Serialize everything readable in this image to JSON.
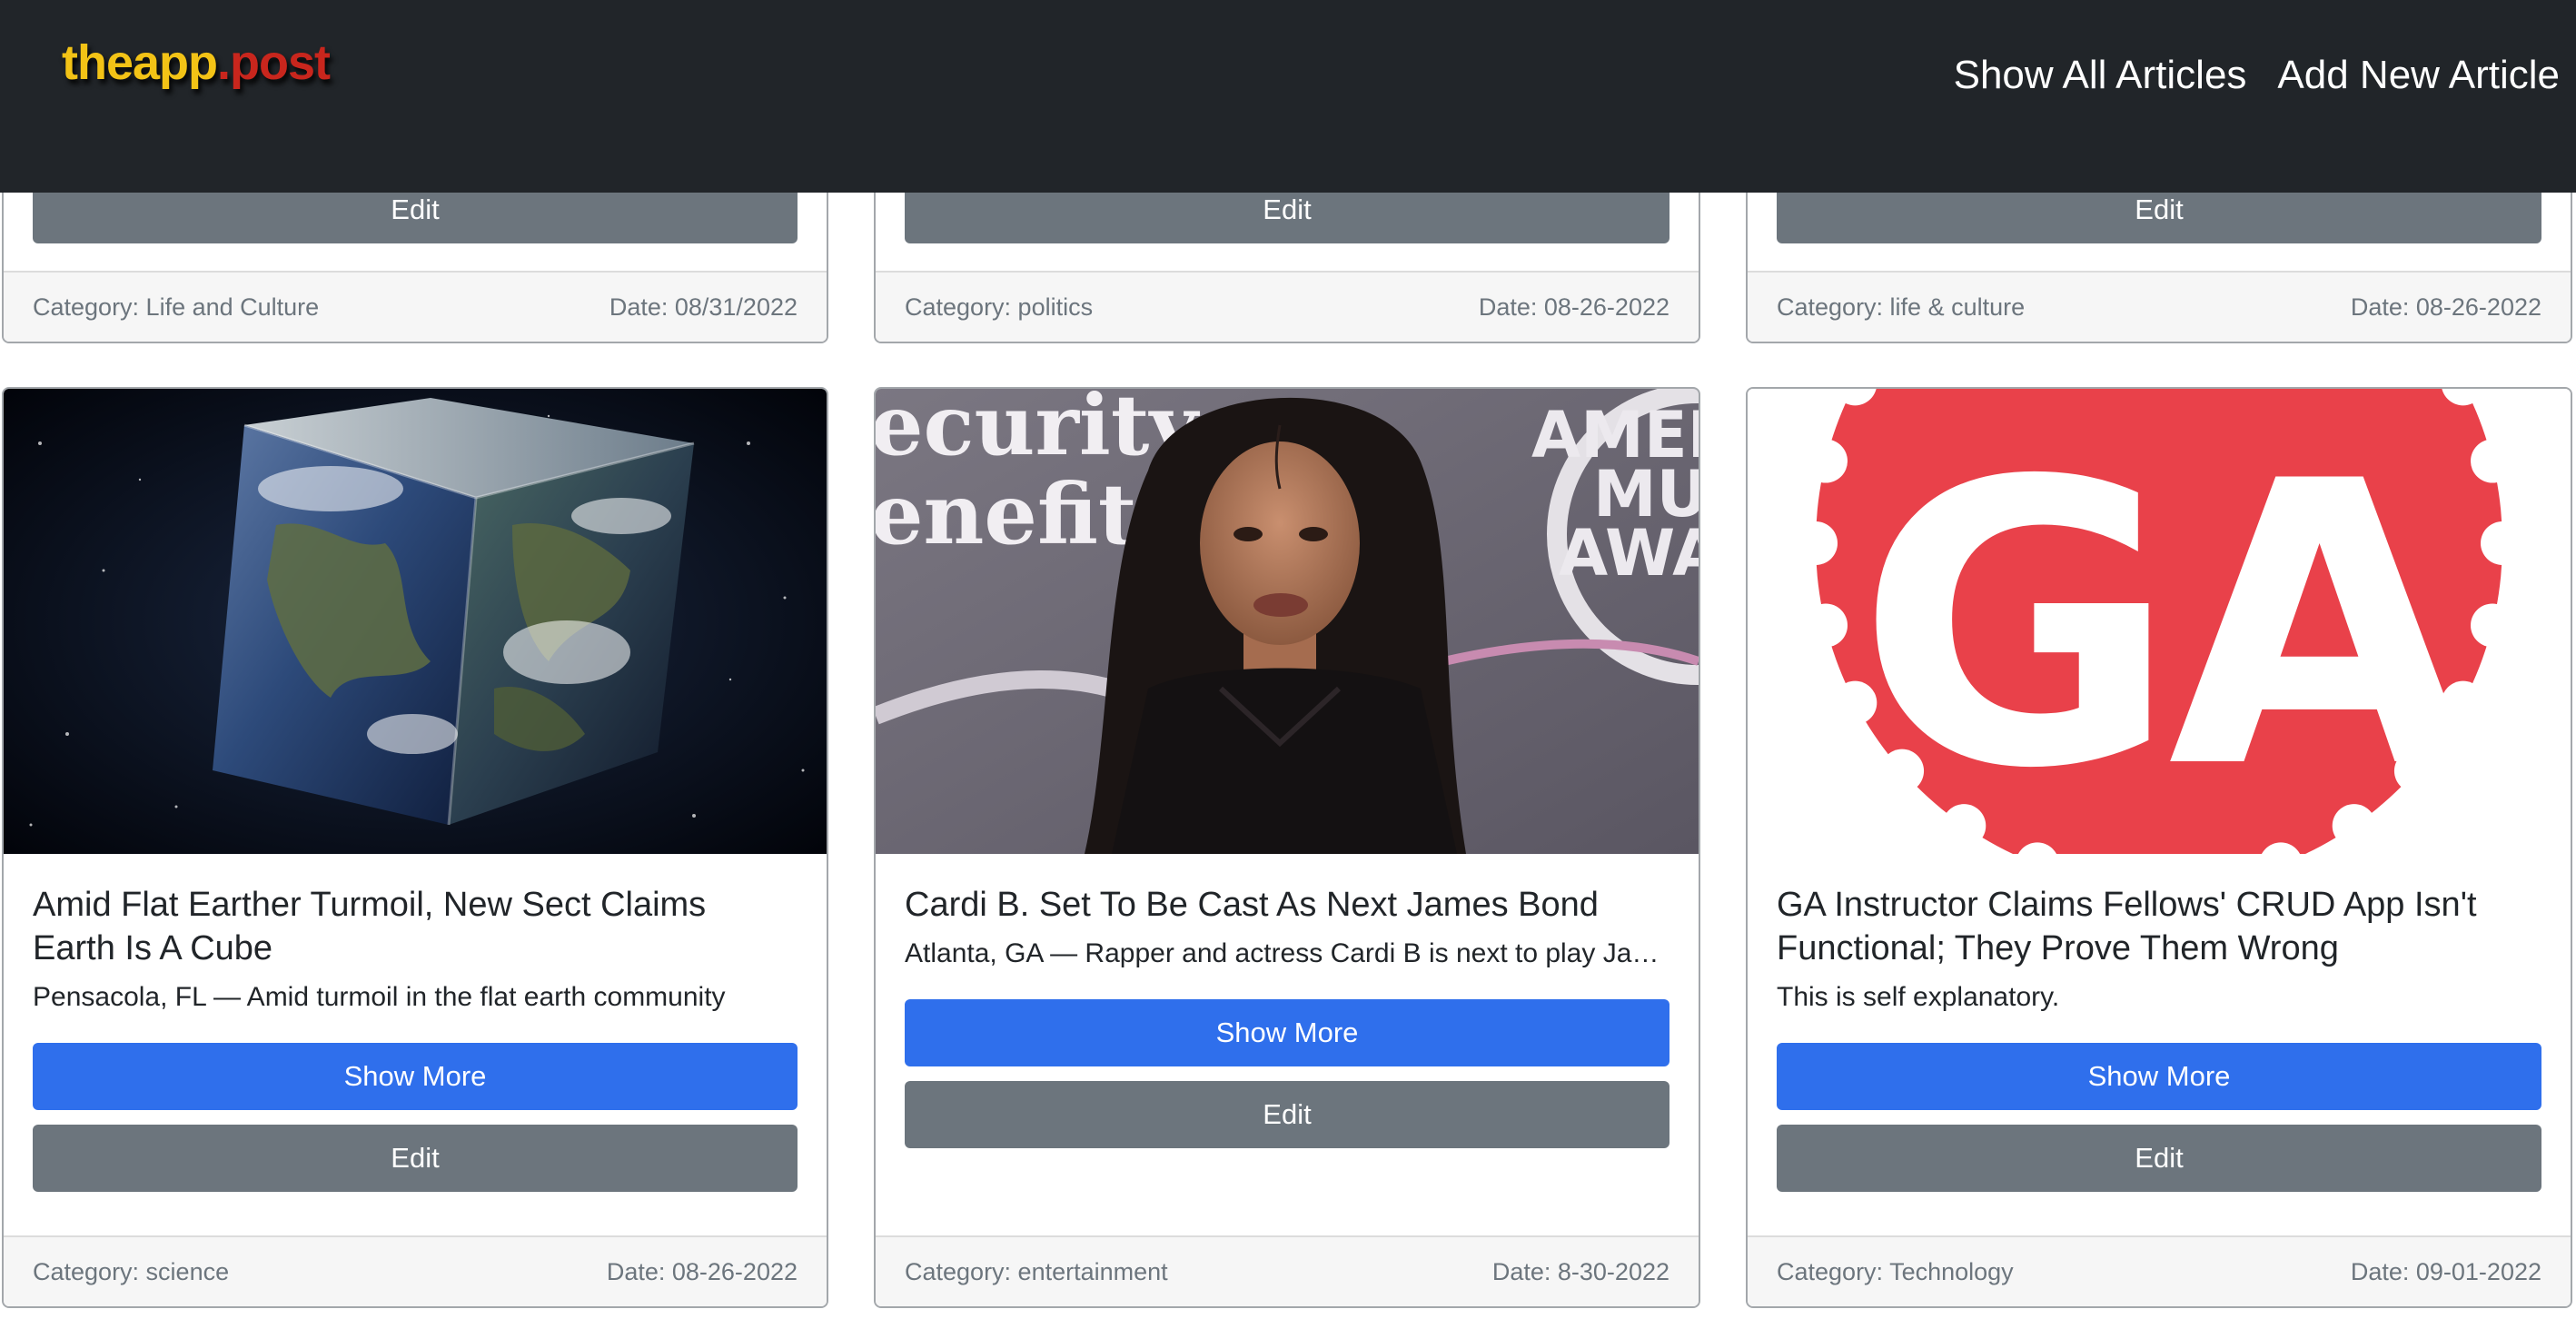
{
  "navbar": {
    "logo_part1": "theapp",
    "logo_part2": ".post",
    "links": [
      "Show All Articles",
      "Add New Article"
    ]
  },
  "top_row": [
    {
      "edit_label": "Edit",
      "category": "Category: Life and Culture",
      "date": "Date: 08/31/2022"
    },
    {
      "edit_label": "Edit",
      "category": "Category: politics",
      "date": "Date: 08-26-2022"
    },
    {
      "edit_label": "Edit",
      "category": "Category: life & culture",
      "date": "Date: 08-26-2022"
    }
  ],
  "articles": [
    {
      "image": "earth-cube-image",
      "title": "Amid Flat Earther Turmoil, New Sect Claims Earth Is A Cube",
      "snippet": "Pensacola, FL — Amid turmoil in the flat earth community",
      "show_more_label": "Show More",
      "edit_label": "Edit",
      "category": "Category: science",
      "date": "Date: 08-26-2022"
    },
    {
      "image": "cardi-b-photo",
      "title": "Cardi B. Set To Be Cast As Next James Bond",
      "snippet": "Atlanta, GA — Rapper and actress Cardi B is next to play James Bond",
      "show_more_label": "Show More",
      "edit_label": "Edit",
      "category": "Category: entertainment",
      "date": "Date: 8-30-2022",
      "backdrop_text": [
        "ecurity",
        "enefit",
        "AMER",
        "MUS",
        "AWA"
      ]
    },
    {
      "image": "ga-logo-image",
      "title": "GA Instructor Claims Fellows' CRUD App Isn't Functional; They Prove Them Wrong",
      "snippet": "This is self explanatory.",
      "show_more_label": "Show More",
      "edit_label": "Edit",
      "category": "Category: Technology",
      "date": "Date: 09-01-2022",
      "logo_text": "GA"
    }
  ],
  "colors": {
    "navbar_bg": "#212529",
    "primary_button": "#2f6fec",
    "secondary_button": "#6c757d",
    "ga_red": "#e9414a"
  }
}
